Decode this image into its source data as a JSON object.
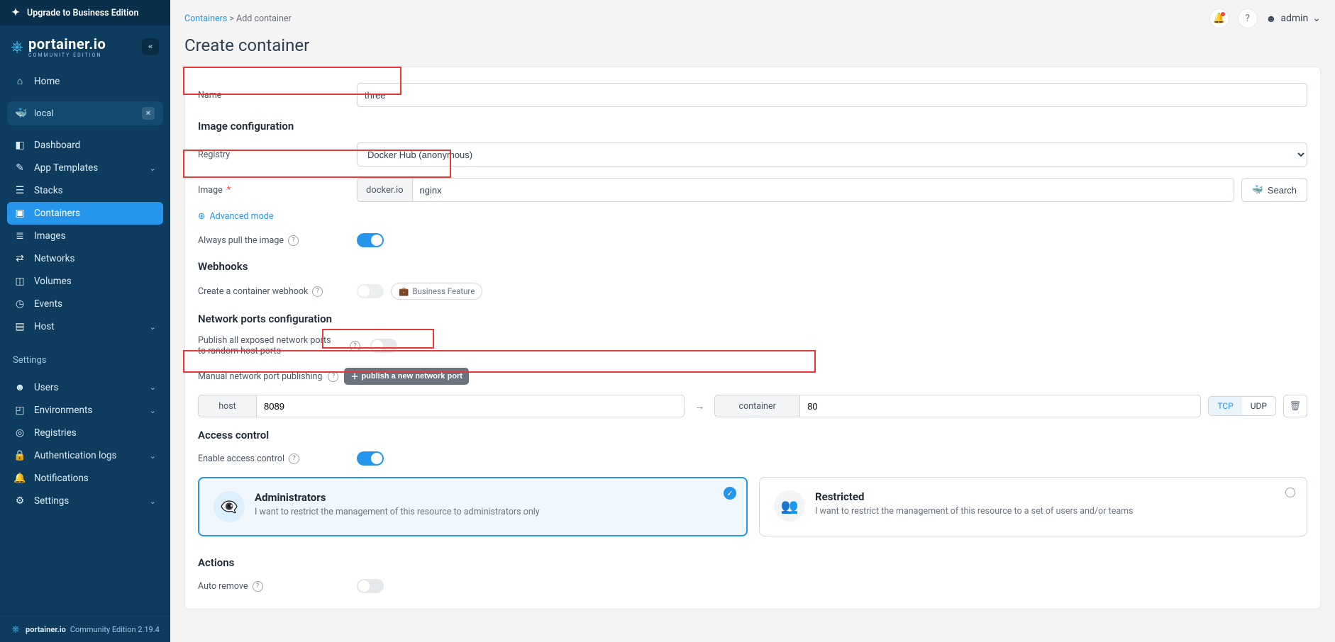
{
  "upgradeBar": "Upgrade to Business Edition",
  "logo": {
    "main": "portainer.io",
    "sub": "COMMUNITY EDITION"
  },
  "nav": {
    "home": "Home",
    "env": "local",
    "items": [
      "Dashboard",
      "App Templates",
      "Stacks",
      "Containers",
      "Images",
      "Networks",
      "Volumes",
      "Events",
      "Host"
    ],
    "settingsLabel": "Settings",
    "settings": [
      "Users",
      "Environments",
      "Registries",
      "Authentication logs",
      "Notifications",
      "Settings"
    ]
  },
  "footer": {
    "brand": "portainer.io",
    "rest": "Community Edition 2.19.4"
  },
  "breadcrumbs": {
    "a": "Containers",
    "sep": ">",
    "b": "Add container"
  },
  "pageTitle": "Create container",
  "user": "admin",
  "form": {
    "nameLabel": "Name",
    "nameValue": "three",
    "imageConfig": "Image configuration",
    "registryLabel": "Registry",
    "registryValue": "Docker Hub (anonymous)",
    "imageLabel": "Image",
    "imagePrefix": "docker.io",
    "imageValue": "nginx",
    "searchBtn": "Search",
    "advanced": "Advanced mode",
    "alwaysPull": "Always pull the image",
    "webhooksH": "Webhooks",
    "webhookLabel": "Create a container webhook",
    "bizBadge": "Business Feature",
    "netH": "Network ports configuration",
    "publishAll": "Publish all exposed network ports to random host ports",
    "manualLabel": "Manual network port publishing",
    "publishBtn": "publish a new network port",
    "port": {
      "hostLabel": "host",
      "hostVal": "8089",
      "conLabel": "container",
      "conVal": "80",
      "tcp": "TCP",
      "udp": "UDP"
    },
    "accessH": "Access control",
    "enableAC": "Enable access control",
    "admins": {
      "title": "Administrators",
      "desc": "I want to restrict the management of this resource to administrators only"
    },
    "restricted": {
      "title": "Restricted",
      "desc": "I want to restrict the management of this resource to a set of users and/or teams"
    },
    "actionsH": "Actions",
    "autoRemove": "Auto remove"
  }
}
